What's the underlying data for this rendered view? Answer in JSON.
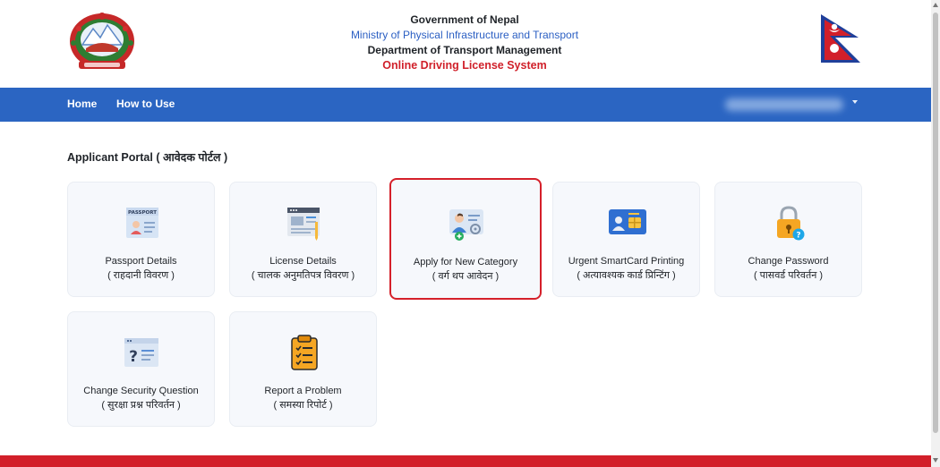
{
  "header": {
    "line1": "Government of Nepal",
    "line2": "Ministry of Physical Infrastructure and Transport",
    "line3": "Department of Transport Management",
    "line4": "Online Driving License System",
    "emblem_icon": "nepal-emblem-icon",
    "flag_icon": "nepal-flag-icon"
  },
  "nav": {
    "home": "Home",
    "how_to_use": "How to Use",
    "user_menu_caret_icon": "caret-down-icon"
  },
  "portal": {
    "title": "Applicant Portal ( आवेदक पोर्टल )",
    "cards": [
      {
        "en": "Passport Details",
        "np": "( राहदानी विवरण )",
        "icon": "passport-icon"
      },
      {
        "en": "License Details",
        "np": "( चालक अनुमतिपत्र विवरण )",
        "icon": "license-document-icon"
      },
      {
        "en": "Apply for New Category",
        "np": "( वर्ग थप आवेदन )",
        "icon": "driver-card-add-icon"
      },
      {
        "en": "Urgent SmartCard Printing",
        "np": "( अत्यावश्यक कार्ड प्रिन्टिंग )",
        "icon": "smartcard-icon"
      },
      {
        "en": "Change Password",
        "np": "( पासवर्ड परिवर्तन )",
        "icon": "lock-question-icon"
      },
      {
        "en": "Change Security Question",
        "np": "( सुरक्षा प्रश्न परिवर्तन )",
        "icon": "security-question-icon"
      },
      {
        "en": "Report a Problem",
        "np": "( समस्या रिपोर्ट )",
        "icon": "clipboard-checklist-icon"
      }
    ]
  },
  "colors": {
    "nav_blue": "#2b65c2",
    "accent_red": "#d21f2a",
    "ministry_blue": "#2b5fc3",
    "card_bg": "#f6f8fc"
  }
}
